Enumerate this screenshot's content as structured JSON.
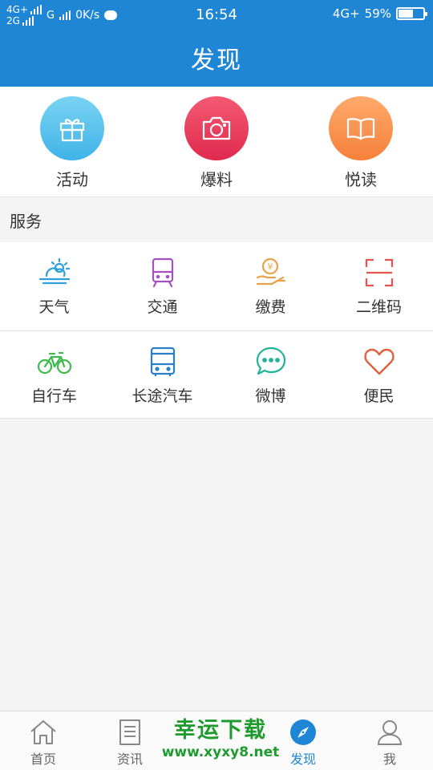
{
  "status_bar": {
    "net_top": "4G+",
    "net_bottom": "2G",
    "sim2": "G",
    "speed": "0K/s",
    "time": "16:54",
    "net_right": "4G+",
    "battery_percent": "59%",
    "battery_level": 0.59
  },
  "header": {
    "title": "发现"
  },
  "features": [
    {
      "label": "活动",
      "icon": "gift-icon",
      "color": "#4fbbec"
    },
    {
      "label": "爆料",
      "icon": "camera-icon",
      "color": "#e8385a"
    },
    {
      "label": "悦读",
      "icon": "book-icon",
      "color": "#f78c45"
    }
  ],
  "services": {
    "title": "服务",
    "items": [
      {
        "label": "天气",
        "icon": "weather-icon",
        "color": "#2aa0dc"
      },
      {
        "label": "交通",
        "icon": "train-icon",
        "color": "#a64fc2"
      },
      {
        "label": "缴费",
        "icon": "payment-icon",
        "color": "#e8a24a"
      },
      {
        "label": "二维码",
        "icon": "qrcode-scan-icon",
        "color": "#e0564f"
      },
      {
        "label": "自行车",
        "icon": "bicycle-icon",
        "color": "#3cbb4a"
      },
      {
        "label": "长途汽车",
        "icon": "bus-icon",
        "color": "#2a7fc9"
      },
      {
        "label": "微博",
        "icon": "chat-bubble-icon",
        "color": "#1fb39a"
      },
      {
        "label": "便民",
        "icon": "heart-icon",
        "color": "#e0603b"
      }
    ]
  },
  "bottom_nav": {
    "items": [
      {
        "label": "首页",
        "icon": "home-icon",
        "active": false
      },
      {
        "label": "资讯",
        "icon": "document-icon",
        "active": false
      },
      {
        "label": "",
        "icon": "placeholder-icon",
        "active": false
      },
      {
        "label": "发现",
        "icon": "compass-icon",
        "active": true
      },
      {
        "label": "我",
        "icon": "user-icon",
        "active": false
      }
    ]
  },
  "watermark": {
    "title": "幸运下载",
    "url": "www.xyxy8.net"
  },
  "colors": {
    "brand_blue": "#1f86d6",
    "background": "#f4f4f4",
    "active_nav": "#1f86d6"
  }
}
